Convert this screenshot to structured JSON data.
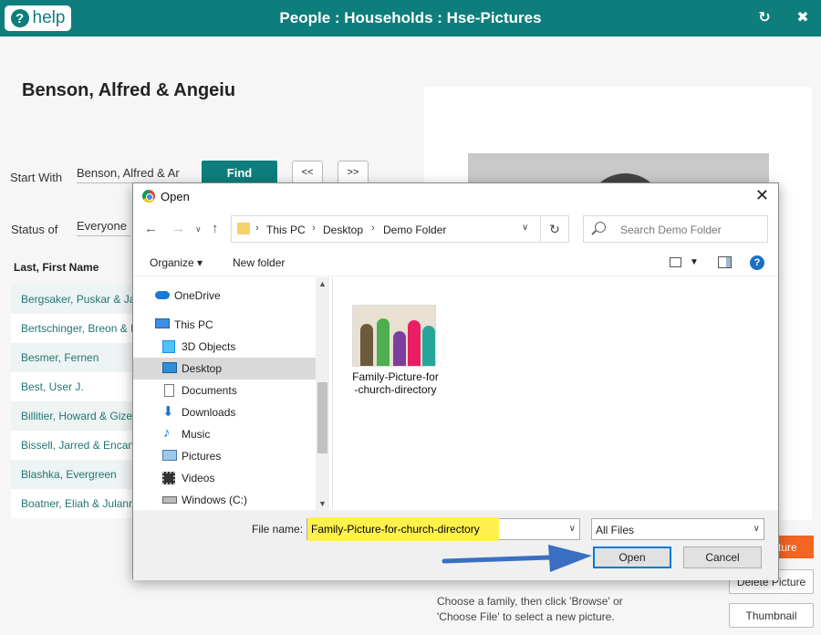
{
  "app": {
    "help_label": "help",
    "title": "People : Households : Hse-Pictures"
  },
  "household": {
    "name": "Benson, Alfred & Angeiu"
  },
  "search": {
    "start_with_label": "Start With",
    "start_with_value": "Benson, Alfred & Ar",
    "find_label": "Find",
    "prev_label": "<<",
    "next_label": ">>",
    "status_label": "Status of",
    "status_value": "Everyone"
  },
  "list": {
    "header": "Last, First Name",
    "rows": [
      "Bergsaker, Puskar & Jat",
      "Bertschinger, Breon & N",
      "Besmer, Fernen",
      "Best, User J.",
      "Billitier, Howard & Gize",
      "Bissell, Jarred & Encanc",
      "Blashka, Evergreen",
      "Boatner, Eliah & Julann"
    ]
  },
  "side_buttons": {
    "orange_label": "cture",
    "delete_label": "Delete Picture",
    "thumbnail_label": "Thumbnail"
  },
  "hint": "Choose a family, then click 'Browse' or 'Choose File' to select a new picture.",
  "dialog": {
    "title": "Open",
    "breadcrumb": [
      "This PC",
      "Desktop",
      "Demo Folder"
    ],
    "search_placeholder": "Search Demo Folder",
    "organize_label": "Organize",
    "new_folder_label": "New folder",
    "tree": [
      {
        "label": "OneDrive",
        "icon": "cloud-icon"
      },
      {
        "label": "This PC",
        "icon": "computer-icon"
      },
      {
        "label": "3D Objects",
        "icon": "cube-icon"
      },
      {
        "label": "Desktop",
        "icon": "desktop-icon",
        "selected": true
      },
      {
        "label": "Documents",
        "icon": "document-icon"
      },
      {
        "label": "Downloads",
        "icon": "download-icon"
      },
      {
        "label": "Music",
        "icon": "music-icon"
      },
      {
        "label": "Pictures",
        "icon": "pictures-icon"
      },
      {
        "label": "Videos",
        "icon": "video-icon"
      },
      {
        "label": "Windows (C:)",
        "icon": "drive-icon"
      }
    ],
    "file": {
      "name": "Family-Picture-for-church-directory"
    },
    "file_name_label": "File name:",
    "file_name_value": "Family-Picture-for-church-directory",
    "filter_value": "All Files",
    "open_label": "Open",
    "cancel_label": "Cancel",
    "highlight_color": "#fff14d",
    "arrow_color": "#3a6fc4"
  },
  "colors": {
    "brand": "#0e7e7c",
    "orange": "#f26522"
  }
}
